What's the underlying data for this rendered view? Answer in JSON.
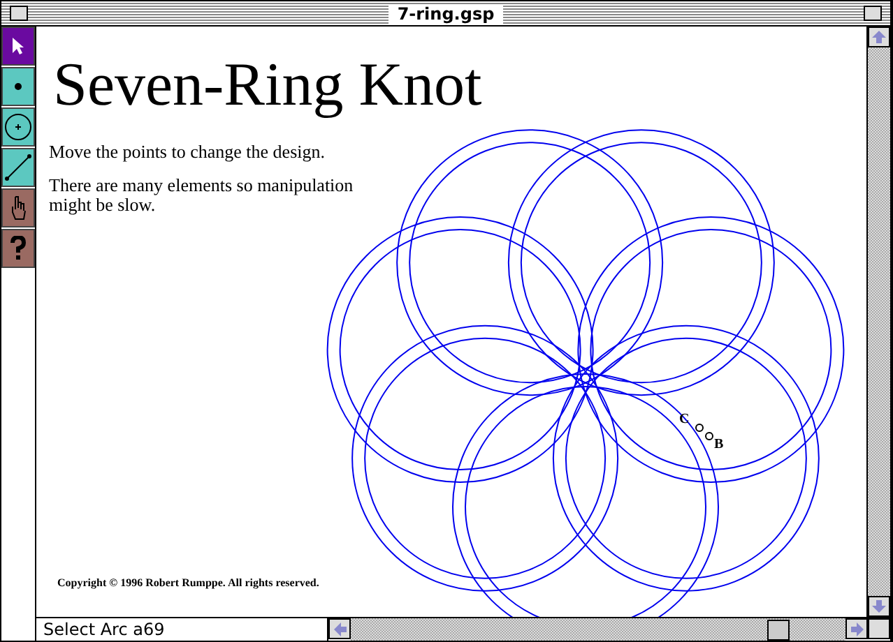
{
  "window": {
    "title": "7-ring.gsp"
  },
  "tools": [
    {
      "kind": "arrow",
      "selected": true
    },
    {
      "kind": "point",
      "selected": false
    },
    {
      "kind": "compass",
      "selected": false
    },
    {
      "kind": "line",
      "selected": false
    },
    {
      "kind": "hand",
      "selected": false
    },
    {
      "kind": "help",
      "selected": false
    }
  ],
  "document": {
    "heading": "Seven-Ring Knot",
    "paragraphs": [
      "Move the points to change the design.",
      "There are many elements so manipulation might be slow."
    ],
    "points": [
      "C",
      "B"
    ],
    "copyright": "Copyright © 1996 Robert Rumppe.  All rights reserved."
  },
  "status_bar": {
    "text": "Select Arc a69"
  }
}
